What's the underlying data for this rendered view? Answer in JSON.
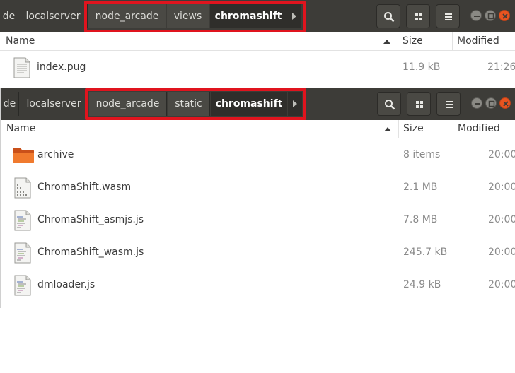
{
  "windows": [
    {
      "breadcrumbs": [
        "de",
        "localserver",
        "node_arcade",
        "views",
        "chromashift"
      ],
      "columns": {
        "name": "Name",
        "size": "Size",
        "modified": "Modified"
      },
      "files": [
        {
          "name": "index.pug",
          "size": "11.9 kB",
          "modified": "21:26",
          "icon": "text-file-icon"
        }
      ]
    },
    {
      "breadcrumbs": [
        "de",
        "localserver",
        "node_arcade",
        "static",
        "chromashift"
      ],
      "columns": {
        "name": "Name",
        "size": "Size",
        "modified": "Modified"
      },
      "files": [
        {
          "name": "archive",
          "size": "8 items",
          "modified": "20:00",
          "icon": "folder-icon"
        },
        {
          "name": "ChromaShift.wasm",
          "size": "2.1 MB",
          "modified": "20:00",
          "icon": "binary-file-icon"
        },
        {
          "name": "ChromaShift_asmjs.js",
          "size": "7.8 MB",
          "modified": "20:00",
          "icon": "script-file-icon"
        },
        {
          "name": "ChromaShift_wasm.js",
          "size": "245.7 kB",
          "modified": "20:00",
          "icon": "script-file-icon"
        },
        {
          "name": "dmloader.js",
          "size": "24.9 kB",
          "modified": "20:00",
          "icon": "script-file-icon"
        }
      ]
    }
  ],
  "colors": {
    "highlight": "#e0141e",
    "titlebar": "#3d3c38",
    "close": "#e95420"
  }
}
